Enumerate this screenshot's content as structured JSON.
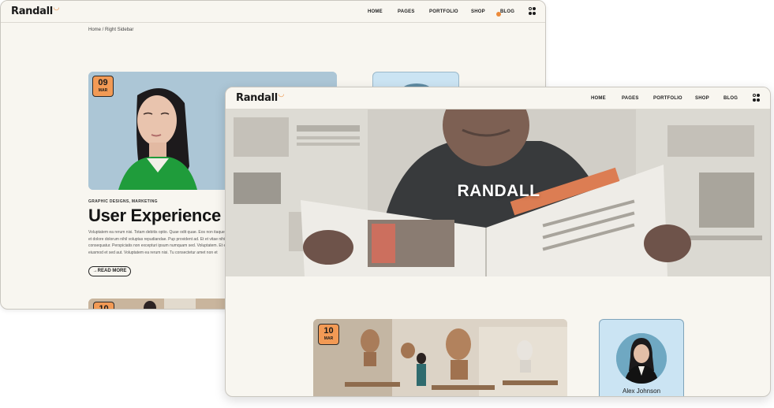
{
  "back_window": {
    "logo": "Randall",
    "nav": [
      "HOME",
      "PAGES",
      "PORTFOLIO",
      "SHOP",
      "BLOG"
    ],
    "breadcrumb": "Home / Right Sidebar",
    "featured_post": {
      "date_day": "09",
      "date_month": "MAR",
      "category": "GRAPHIC DESIGNS, MARKETING",
      "title": "User Experience",
      "excerpt": "Voluptatem ea rerum nisi. Totam debitis optio. Quae odit quae. Eos non itaque et dolore dolorum nihil voluptas repudiandae. Pup provident ad. Et et vitae nihil consequatur. Perspiciatis non excepturi ipsum numquam sed. Voluptatem. Et et eiusmod et sed aut. Voluptatem ea rerum nisi. Tu consectetur amet non et bibendum.",
      "read_more": "READ MORE"
    },
    "next_post": {
      "date_day": "10"
    }
  },
  "front_window": {
    "logo": "Randall",
    "nav": [
      "HOME",
      "PAGES",
      "PORTFOLIO",
      "SHOP",
      "BLOG"
    ],
    "banner_title": "RANDALL",
    "post": {
      "date_day": "10",
      "date_month": "MAR"
    },
    "author": {
      "name": "Alex Johnson"
    }
  },
  "colors": {
    "accent": "#ec8a3a",
    "page_bg": "#f8f6f0",
    "author_card": "#cbe4f3"
  }
}
